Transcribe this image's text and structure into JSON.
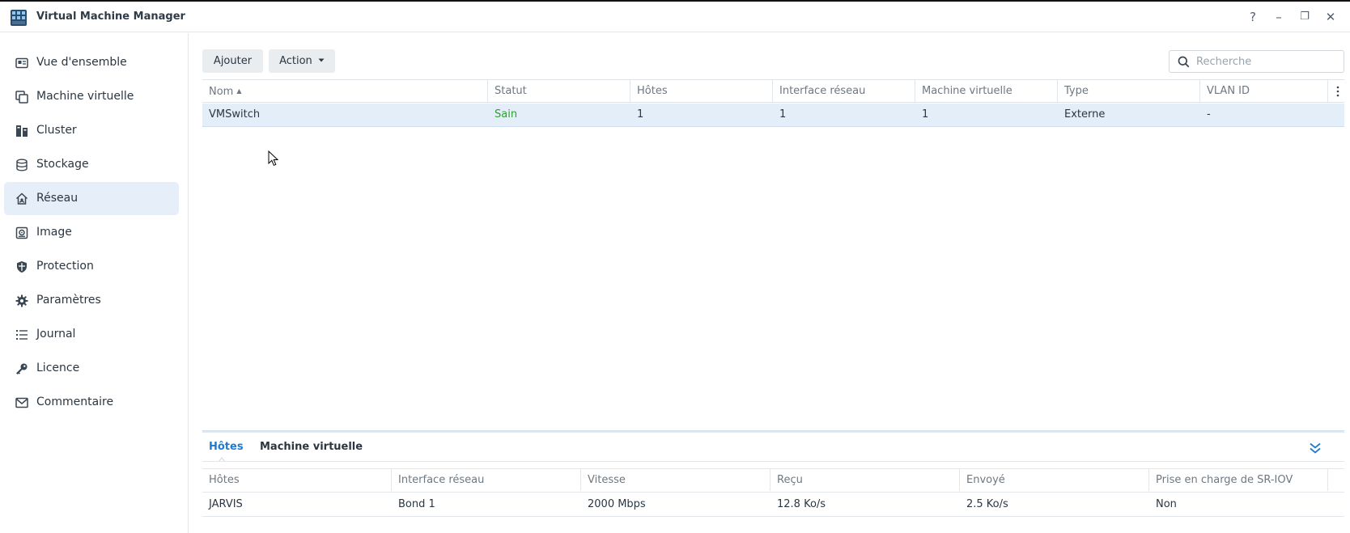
{
  "app": {
    "title": "Virtual Machine Manager",
    "window_controls": {
      "help": "?",
      "minimize": "–",
      "restore": "❐",
      "close": "✕"
    }
  },
  "sidebar": {
    "items": [
      {
        "label": "Vue d'ensemble",
        "icon": "overview-icon"
      },
      {
        "label": "Machine virtuelle",
        "icon": "virtual-machine-icon"
      },
      {
        "label": "Cluster",
        "icon": "cluster-icon"
      },
      {
        "label": "Stockage",
        "icon": "storage-icon"
      },
      {
        "label": "Réseau",
        "icon": "network-icon",
        "active": true
      },
      {
        "label": "Image",
        "icon": "image-icon"
      },
      {
        "label": "Protection",
        "icon": "shield-icon"
      },
      {
        "label": "Paramètres",
        "icon": "gear-icon"
      },
      {
        "label": "Journal",
        "icon": "list-icon"
      },
      {
        "label": "Licence",
        "icon": "key-icon"
      },
      {
        "label": "Commentaire",
        "icon": "mail-icon"
      }
    ]
  },
  "toolbar": {
    "add_label": "Ajouter",
    "action_label": "Action",
    "search_placeholder": "Recherche"
  },
  "grid": {
    "columns": [
      "Nom",
      "Statut",
      "Hôtes",
      "Interface réseau",
      "Machine virtuelle",
      "Type",
      "VLAN ID"
    ],
    "rows": [
      {
        "name": "VMSwitch",
        "status": "Sain",
        "hosts": "1",
        "interfaces": "1",
        "vms": "1",
        "type": "Externe",
        "vlan": "-"
      }
    ]
  },
  "detail": {
    "tabs": [
      "Hôtes",
      "Machine virtuelle"
    ],
    "active_tab": 0,
    "columns": [
      "Hôtes",
      "Interface réseau",
      "Vitesse",
      "Reçu",
      "Envoyé",
      "Prise en charge de SR-IOV"
    ],
    "rows": [
      {
        "host": "JARVIS",
        "interface": "Bond 1",
        "speed": "2000 Mbps",
        "received": "12.8 Ko/s",
        "sent": "2.5 Ko/s",
        "sriov": "Non"
      }
    ]
  },
  "colors": {
    "accent": "#1f7ad1",
    "status_ok": "#2f9e2f",
    "selected_row": "#e3eef9",
    "active_nav": "#e6eefa"
  }
}
